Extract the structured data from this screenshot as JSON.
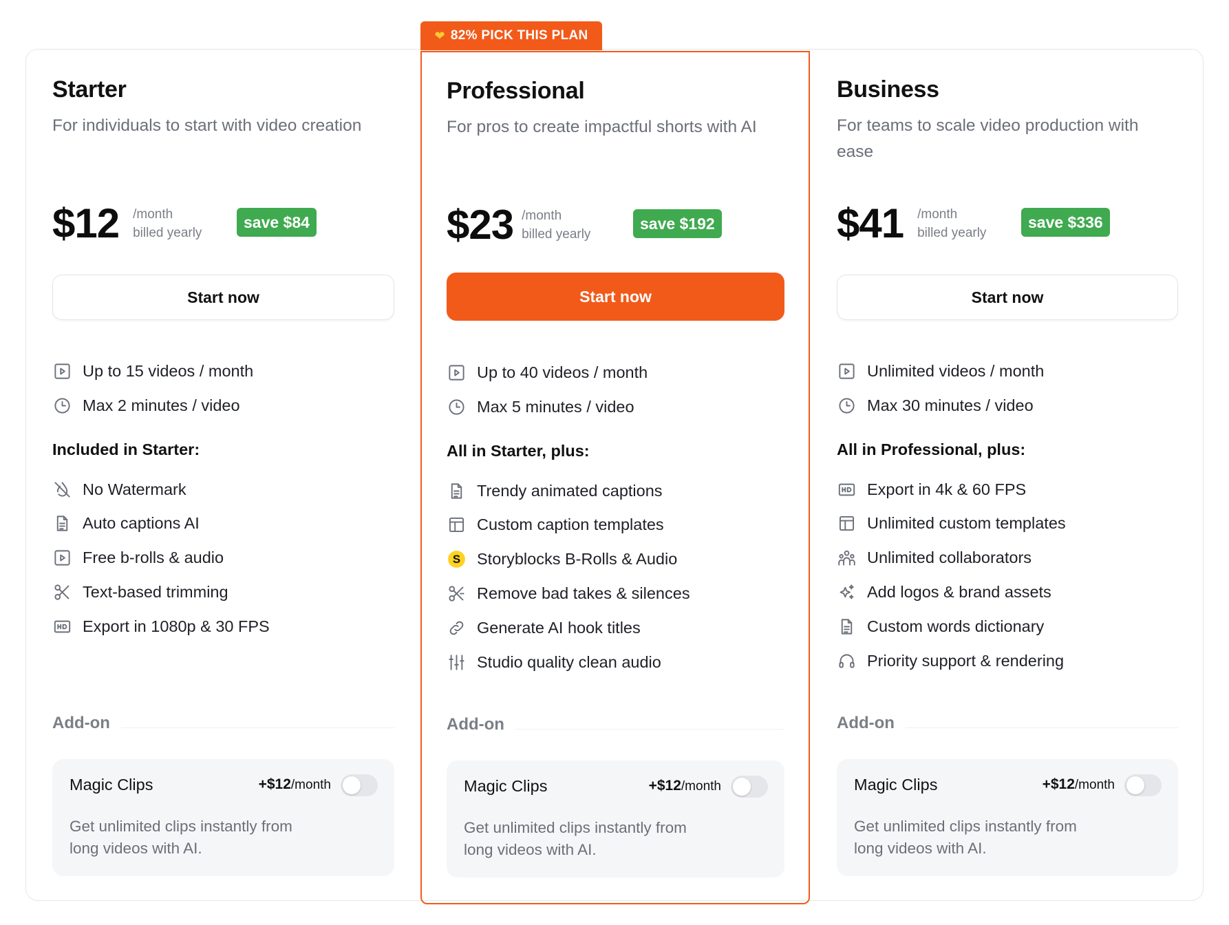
{
  "badge": {
    "icon": "heart-icon",
    "text": "82% PICK THIS PLAN"
  },
  "colors": {
    "accent": "#f25a1a",
    "save": "#3faa4f"
  },
  "plans": [
    {
      "title": "Starter",
      "description": "For individuals to start with video creation",
      "price": "$12",
      "per_line1": "/month",
      "per_line2": "billed yearly",
      "save": "save $84",
      "cta": "Start now",
      "limits": [
        {
          "icon": "play-icon",
          "text": "Up to 15 videos / month"
        },
        {
          "icon": "clock-icon",
          "text": "Max 2 minutes / video"
        }
      ],
      "section_title": "Included in Starter:",
      "features": [
        {
          "icon": "no-watermark-icon",
          "text": "No Watermark"
        },
        {
          "icon": "document-icon",
          "text": "Auto captions AI"
        },
        {
          "icon": "play-icon",
          "text": "Free b-rolls & audio"
        },
        {
          "icon": "scissors-icon",
          "text": "Text-based trimming"
        },
        {
          "icon": "hd-icon",
          "text": "Export in 1080p & 30 FPS"
        }
      ],
      "addon_label": "Add-on",
      "addon": {
        "name": "Magic Clips",
        "price": "+$12",
        "unit": "/month",
        "description": "Get unlimited clips instantly from long videos with AI."
      }
    },
    {
      "title": "Professional",
      "description": "For pros to create impactful shorts with AI",
      "price": "$23",
      "per_line1": "/month",
      "per_line2": "billed yearly",
      "save": "save $192",
      "cta": "Start now",
      "limits": [
        {
          "icon": "play-icon",
          "text": "Up to 40 videos / month"
        },
        {
          "icon": "clock-icon",
          "text": "Max 5 minutes / video"
        }
      ],
      "section_title": "All in Starter, plus:",
      "features": [
        {
          "icon": "document-icon",
          "text": "Trendy animated captions"
        },
        {
          "icon": "layout-icon",
          "text": "Custom caption templates"
        },
        {
          "icon": "storyblocks-icon",
          "text": "Storyblocks B-Rolls & Audio"
        },
        {
          "icon": "scissors-icon",
          "text": "Remove bad takes & silences"
        },
        {
          "icon": "link-icon",
          "text": "Generate AI hook titles"
        },
        {
          "icon": "sliders-icon",
          "text": "Studio quality clean audio"
        }
      ],
      "addon_label": "Add-on",
      "addon": {
        "name": "Magic Clips",
        "price": "+$12",
        "unit": "/month",
        "description": "Get unlimited clips instantly from long videos with AI."
      }
    },
    {
      "title": "Business",
      "description": "For teams to scale video production with ease",
      "price": "$41",
      "per_line1": "/month",
      "per_line2": "billed yearly",
      "save": "save $336",
      "cta": "Start now",
      "limits": [
        {
          "icon": "play-icon",
          "text": "Unlimited videos / month"
        },
        {
          "icon": "clock-icon",
          "text": "Max 30 minutes / video"
        }
      ],
      "section_title": "All in Professional, plus:",
      "features": [
        {
          "icon": "hd-icon",
          "text": "Export in 4k & 60 FPS"
        },
        {
          "icon": "layout-icon",
          "text": "Unlimited custom templates"
        },
        {
          "icon": "users-icon",
          "text": "Unlimited collaborators"
        },
        {
          "icon": "sparkles-icon",
          "text": "Add logos & brand assets"
        },
        {
          "icon": "document-icon",
          "text": "Custom words dictionary"
        },
        {
          "icon": "headset-icon",
          "text": "Priority support & rendering"
        }
      ],
      "addon_label": "Add-on",
      "addon": {
        "name": "Magic Clips",
        "price": "+$12",
        "unit": "/month",
        "description": "Get unlimited clips instantly from long videos with AI."
      }
    }
  ]
}
